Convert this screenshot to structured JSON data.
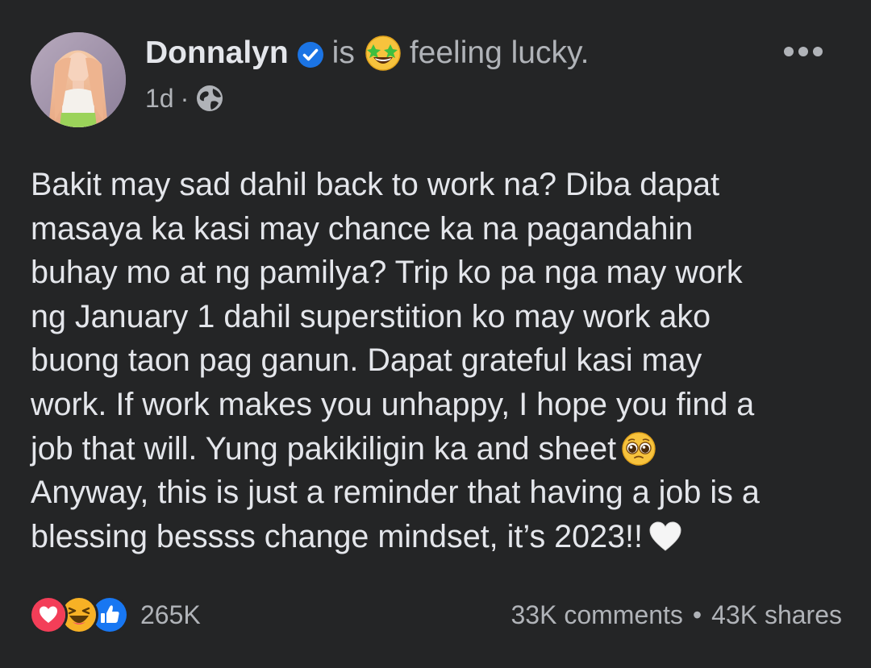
{
  "post": {
    "author": "Donnalyn",
    "verb": "is",
    "feeling": "feeling lucky.",
    "time": "1d",
    "time_separator": "·",
    "audience_icon": "globe-icon",
    "more_icon": "more-options-icon",
    "body_lines": [
      "Bakit may sad dahil back to work na? Diba dapat",
      "masaya ka kasi may chance ka na pagandahin",
      "buhay mo at ng pamilya? Trip ko pa nga may work",
      "ng January 1 dahil superstition ko may work ako",
      "buong taon pag ganun. Dapat grateful kasi may",
      "work. If work makes you unhappy, I hope you find a",
      "job that will. Yung pakikiligin ka and sheet",
      "Anyway, this is just a reminder that having a job is a",
      "blessing bessss change mindset, it’s 2023!!"
    ],
    "inline_emojis": {
      "line7": "pleading-face-emoji",
      "line9": "white-heart-emoji"
    },
    "reactions": {
      "icons": [
        "love-reaction-icon",
        "haha-reaction-icon",
        "like-reaction-icon"
      ],
      "count": "265K"
    },
    "comments": "33K comments",
    "dot": "•",
    "shares": "43K shares"
  },
  "colors": {
    "background": "#242526",
    "primary_text": "#e4e6eb",
    "secondary_text": "#b0b3b8",
    "verified_blue": "#1b74e4",
    "love_red": "#f33e58",
    "like_blue": "#1877f2",
    "haha_yellow": "#f7b125"
  }
}
